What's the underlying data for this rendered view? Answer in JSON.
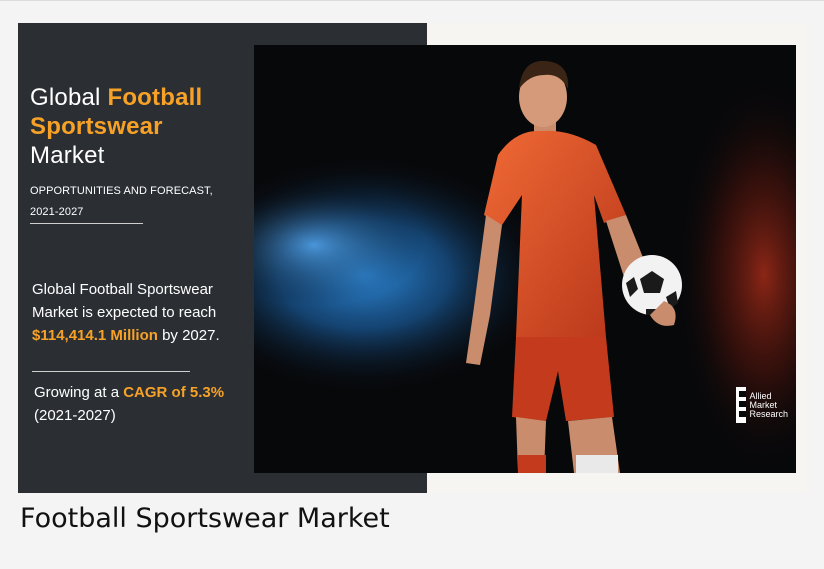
{
  "infographic": {
    "headline": {
      "part1": "Global ",
      "highlight1": "Football",
      "highlight2": "Sportswear",
      "part2": "Market"
    },
    "subtitle": {
      "line1": "OPPORTUNITIES AND FORECAST,",
      "line2": "2021-2027"
    },
    "stat": {
      "line1": "Global Football Sportswear",
      "line2": "Market is expected to reach",
      "highlight": "$114,414.1 Million",
      "line3_rest": " by 2027."
    },
    "growth": {
      "prefix": "Growing at a ",
      "highlight": "CAGR of 5.3%",
      "line2": "(2021-2027)"
    },
    "logo": {
      "line1": "Allied",
      "line2": "Market",
      "line3": "Research"
    }
  },
  "caption": "Football Sportswear Market",
  "colors": {
    "panel": "#2b2f34",
    "accent": "#f7a227",
    "kit": "#e0471f"
  }
}
